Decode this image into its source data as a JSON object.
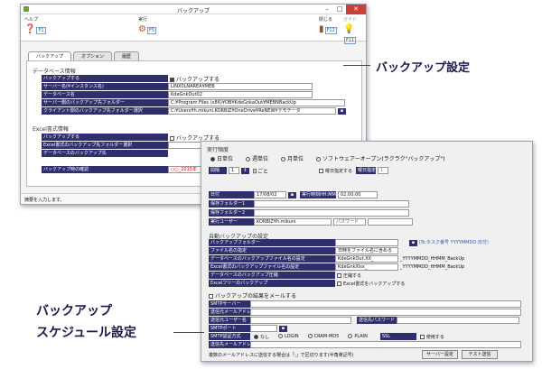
{
  "main_window": {
    "title": "バックアップ",
    "menu": [
      {
        "label": "ヘルプ",
        "key": "F1"
      },
      {
        "label": "実行",
        "key": "F5"
      },
      {
        "label": "閉じる",
        "key": "F12"
      },
      {
        "label": "ガイド",
        "key": "F11"
      }
    ],
    "tabs": [
      "バックアップ",
      "オプション",
      "履歴"
    ],
    "db_section": "データベース情報",
    "db_rows": [
      {
        "label": "バックアップする",
        "value": "バックアップする"
      },
      {
        "label": "サーバー名(¥インスタンス名)",
        "value": "LINX0LNAREA¥MEB"
      },
      {
        "label": "データベース名",
        "value": "KdeGnkOut02"
      },
      {
        "label": "サーバー側のバックアップ先フォルダー",
        "value": "C:¥Program Files (x86)¥OB¥KdeGnkaOut¥MEBNBackUp"
      },
      {
        "label": "クライアント側のバックアップ先フォルダー選択",
        "value": "C:¥Users¥h.mikuni.KORBIZ¥OneDrive¥ReNEW¥デモデータ"
      }
    ],
    "excel_section": "Excel書式情報",
    "excel_rows": [
      {
        "label": "バックアップする",
        "value": "バックアップする"
      },
      {
        "label": "Excel書式のバックアップ先フォルダー選択",
        "value": ""
      },
      {
        "label": "データベースのバックアップ先",
        "value": ""
      }
    ],
    "last_backup_label": "バックアップ時の確認",
    "last_backup_value": "○○_2015年",
    "status": "摘要を入力します。"
  },
  "schedule_window": {
    "freq_label": "実行頻度",
    "freq_options": [
      "日単位",
      "週単位",
      "月単位",
      "ソフトウェアーオープン(ラクラク\"バックアップ\")"
    ],
    "interval_label": "間隔",
    "interval_value": "1",
    "interval_unit": "日ごと",
    "weekday_label": "曜日指定する",
    "weekday_tag": "曜日指定",
    "weekday_value": "1",
    "date_label": "日付",
    "date_value": "17/08/02",
    "time_label": "実行時刻HH:MM",
    "time_value": "02:00:00",
    "save_folder1": "保存フォルダー1",
    "save_folder2": "保存フォルダー2",
    "user_label": "実行ユーザー",
    "user_value": "KORBIZ¥h.mikuni",
    "password_label": "パスワード",
    "auto_title": "自動バックアップの設定",
    "task_note": "(Ts:タスク番号 YYYYMMDD:日付)",
    "auto_rows": [
      {
        "label": "バックアップフォルダー",
        "value": ""
      },
      {
        "label": "ファイル名の指定",
        "value": "日時をファイル名に含める"
      },
      {
        "label": "データベースのバックアップファイル名の設定",
        "value": "KdeGnkOut.XX_",
        "suffix": "_YYYYMMDD_HHMM_BackUp"
      },
      {
        "label": "Excel書式のバックアップファイル名の設定",
        "value": "KdeGnkXlsx_",
        "suffix": "_YYYYMMDD_HHMM_BackUp"
      },
      {
        "label": "データベースのバックアップ圧縮",
        "value": "圧縮する"
      },
      {
        "label": "Excelフリーのバックアップ",
        "value": "Excel書式をバックアップする"
      }
    ],
    "mail_title": "バックアップの結果をメールする",
    "mail_rows": [
      "SMTPサーバー",
      "送信元メールアドレス",
      "送信元ユーザー名",
      "SMTPポート",
      "SMTP認証方式",
      "送信先メールアドレス"
    ],
    "send_password": "送信先パスワード",
    "auth_options": [
      "なし",
      "LOGIN",
      "CRAM-MD5",
      "PLAIN"
    ],
    "ssl_label": "SSL",
    "ssl_use": "使用する",
    "footer_note": "複数のメールアドレスに送信する場合は「;」で区切ります(半角英記号)",
    "btn_server": "サーバー設定",
    "btn_test": "テスト送信"
  },
  "callouts": {
    "right": "バックアップ設定",
    "left1": "バックアップ",
    "left2": "スケジュール設定"
  }
}
